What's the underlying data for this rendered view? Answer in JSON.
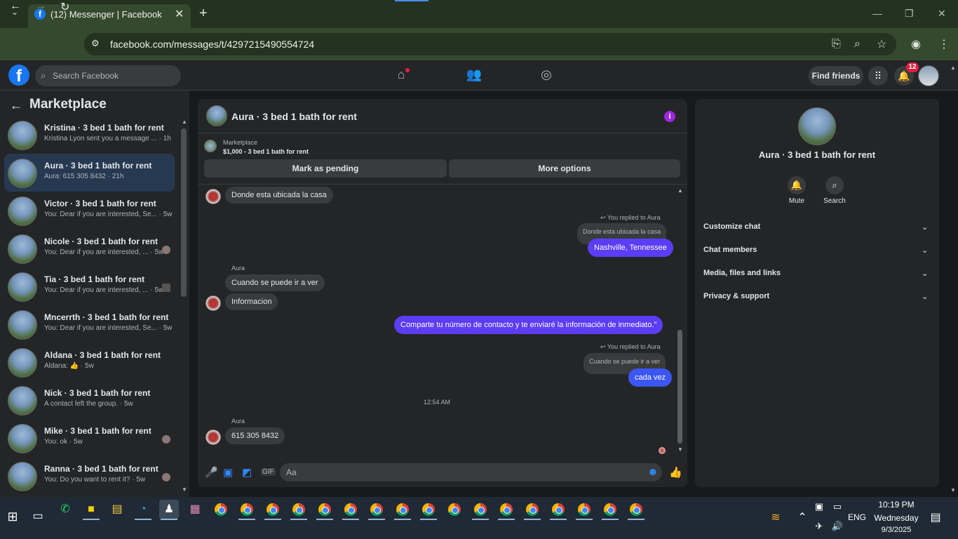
{
  "browser": {
    "tab_title": "(12) Messenger | Facebook",
    "url": "facebook.com/messages/t/4297215490554724"
  },
  "fb": {
    "search_placeholder": "Search Facebook",
    "find_friends": "Find friends",
    "notification_count": "12"
  },
  "left": {
    "title": "Marketplace",
    "conversations": [
      {
        "name": "Kristina · 3 bed 1 bath for rent",
        "preview": "Kristina Lyon sent you a message ... · 1h"
      },
      {
        "name": "Aura · 3 bed 1 bath for rent",
        "preview": "Aura: 615 305 8432 · 21h"
      },
      {
        "name": "Victor · 3 bed 1 bath for rent",
        "preview": "You: Dear if you are interested, Se... · 5w"
      },
      {
        "name": "Nicole · 3 bed 1 bath for rent",
        "preview": "You: Dear if you are interested, ... · 5w"
      },
      {
        "name": "Tia · 3 bed 1 bath for rent",
        "preview": "You: Dear if you are interested, ... · 5w"
      },
      {
        "name": "Mncerrth · 3 bed 1 bath for rent",
        "preview": "You: Dear if you are interested, Se... · 5w"
      },
      {
        "name": "Aldana · 3 bed 1 bath for rent",
        "preview": "Aldana: 👍 · 5w"
      },
      {
        "name": "Nick · 3 bed 1 bath for rent",
        "preview": "A contact left the group. · 5w"
      },
      {
        "name": "Mike · 3 bed 1 bath for rent",
        "preview": "You: ok · 5w"
      },
      {
        "name": "Ranna · 3 bed 1 bath for rent",
        "preview": "You: Do you want to rent it? · 5w"
      }
    ]
  },
  "chat": {
    "title": "Aura · 3 bed 1 bath for rent",
    "marketplace_label": "Marketplace",
    "listing": "$1,000 - 3 bed 1 bath for rent",
    "mark_pending": "Mark as pending",
    "more_options": "More options",
    "msg1": "Donde esta ubicada la casa",
    "replied1": "You replied to Aura",
    "quote1": "Donde esta ubicada la casa",
    "reply1": "Nashville, Tennessee",
    "sender1": "Aura",
    "msg2": "Cuando se puede ir a ver",
    "msg3": "Informacion",
    "out2": "Comparte tu número de contacto y te enviaré la información de inmediato.\"",
    "replied2": "You replied to Aura",
    "quote2": "Cuando se puede ir a ver",
    "reply2": "cada vez",
    "timestamp": "12:54 AM",
    "sender2": "Aura",
    "msg4": "615 305 8432",
    "composer_placeholder": "Aa"
  },
  "right": {
    "title": "Aura · 3 bed 1 bath for rent",
    "mute": "Mute",
    "search": "Search",
    "sections": [
      "Customize chat",
      "Chat members",
      "Media, files and links",
      "Privacy & support"
    ]
  },
  "taskbar": {
    "lang": "ENG",
    "time": "10:19 PM",
    "day": "Wednesday",
    "date": "9/3/2025"
  }
}
